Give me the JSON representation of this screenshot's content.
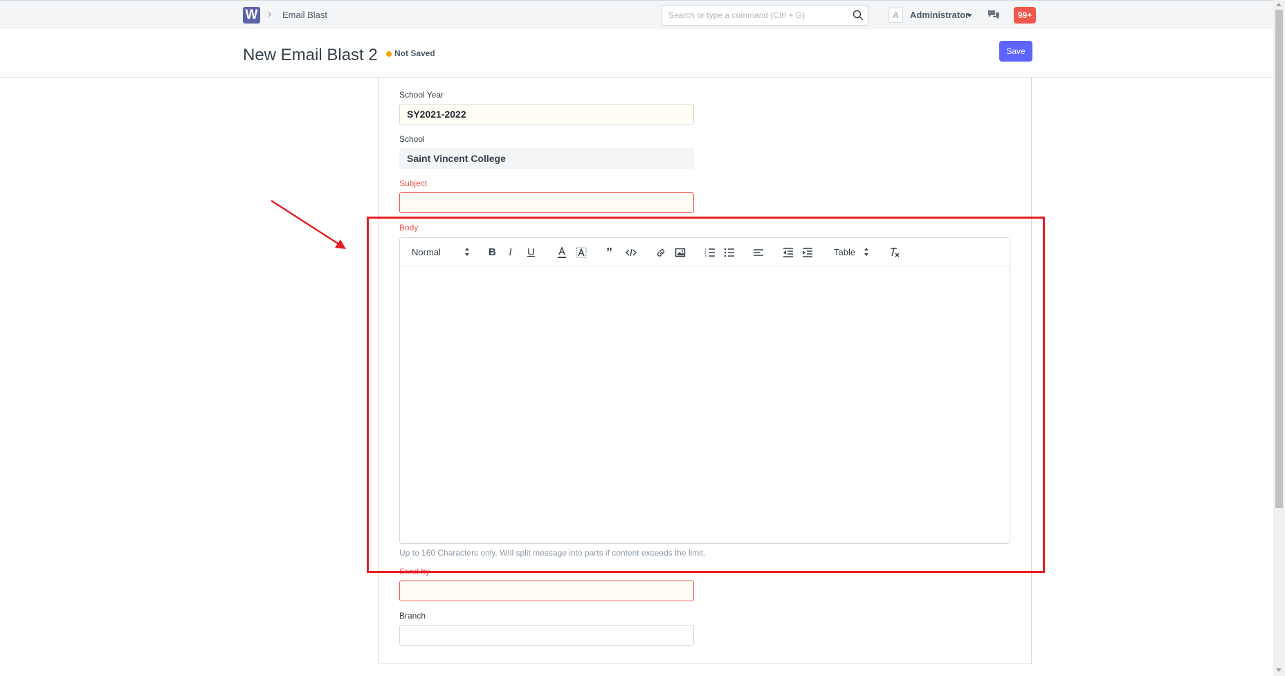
{
  "navbar": {
    "logo_letter": "W",
    "breadcrumb": "Email Blast",
    "search_placeholder": "Search or type a command (Ctrl + G)",
    "avatar_letter": "A",
    "user_name": "Administrator",
    "notification_count": "99+"
  },
  "page": {
    "title": "New Email Blast 2",
    "status": "Not Saved",
    "save_label": "Save"
  },
  "form": {
    "school_year": {
      "label": "School Year",
      "value": "SY2021-2022"
    },
    "school": {
      "label": "School",
      "value": "Saint Vincent College"
    },
    "subject": {
      "label": "Subject",
      "value": ""
    },
    "body": {
      "label": "Body",
      "format_select": "Normal",
      "table_select": "Table",
      "help": "Up to 160 Characters only. WIll split message into parts if content exceeds the limit."
    },
    "send_by": {
      "label": "Send by",
      "value": ""
    },
    "branch": {
      "label": "Branch",
      "value": ""
    }
  },
  "icons": [
    "search-icon",
    "chevron-right-icon",
    "chat-icon",
    "bold-icon",
    "italic-icon",
    "underline-icon",
    "text-color-icon",
    "background-color-icon",
    "blockquote-icon",
    "code-block-icon",
    "link-icon",
    "image-icon",
    "ordered-list-icon",
    "bullet-list-icon",
    "align-icon",
    "outdent-icon",
    "indent-icon",
    "clear-format-icon"
  ],
  "colors": {
    "primary": "#5e64ff",
    "required": "#f2574c",
    "status_dot": "#ffa00a",
    "annotation": "#e51c23",
    "logo": "#5e64a8"
  }
}
